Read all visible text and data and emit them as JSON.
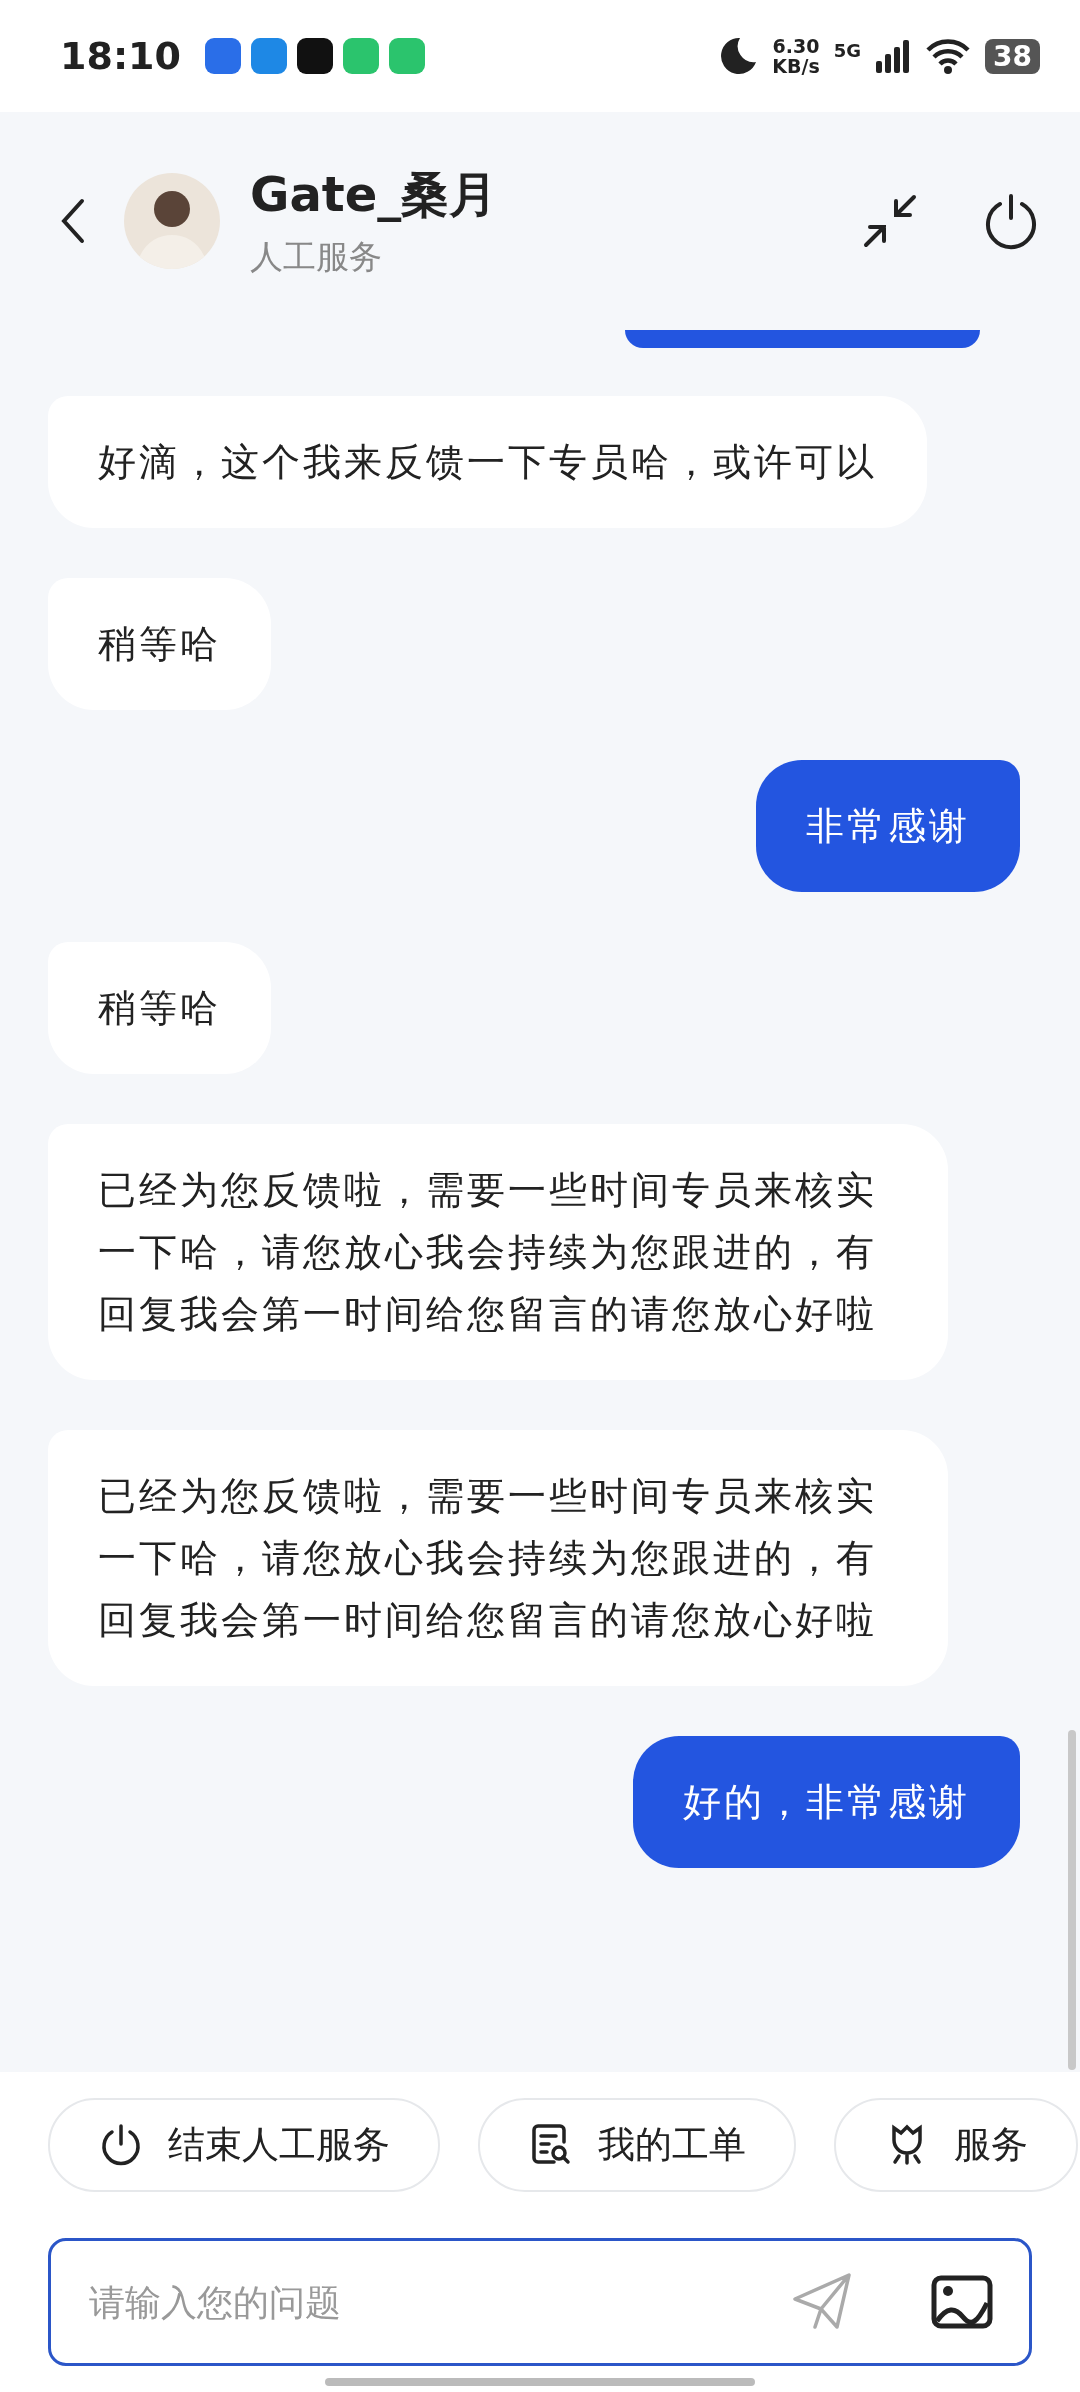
{
  "status_bar": {
    "time": "18:10",
    "notifications": [
      {
        "color": "#2a6ee8"
      },
      {
        "color": "#1e88e5"
      },
      {
        "color": "#111111"
      },
      {
        "color": "#2bc46d"
      },
      {
        "color": "#2bc46d"
      }
    ],
    "speed": "6.30",
    "speed_unit": "KB/s",
    "network": "5G",
    "battery": "38"
  },
  "header": {
    "name": "Gate_桑月",
    "subtitle": "人工服务"
  },
  "messages": [
    {
      "kind": "partial"
    },
    {
      "kind": "received",
      "text": "好滴，这个我来反馈一下专员哈，或许可以"
    },
    {
      "kind": "received",
      "text": "稍等哈"
    },
    {
      "kind": "sent",
      "text": "非常感谢"
    },
    {
      "kind": "received",
      "text": "稍等哈"
    },
    {
      "kind": "received",
      "text": "已经为您反馈啦，需要一些时间专员来核实一下哈，请您放心我会持续为您跟进的，有回复我会第一时间给您留言的请您放心好啦"
    },
    {
      "kind": "received",
      "text": "已经为您反馈啦，需要一些时间专员来核实一下哈，请您放心我会持续为您跟进的，有回复我会第一时间给您留言的请您放心好啦"
    },
    {
      "kind": "sent",
      "text": "好的，非常感谢"
    }
  ],
  "quick_actions": [
    {
      "label": "结束人工服务"
    },
    {
      "label": "我的工单"
    },
    {
      "label": "服务"
    }
  ],
  "input": {
    "placeholder": "请输入您的问题"
  }
}
